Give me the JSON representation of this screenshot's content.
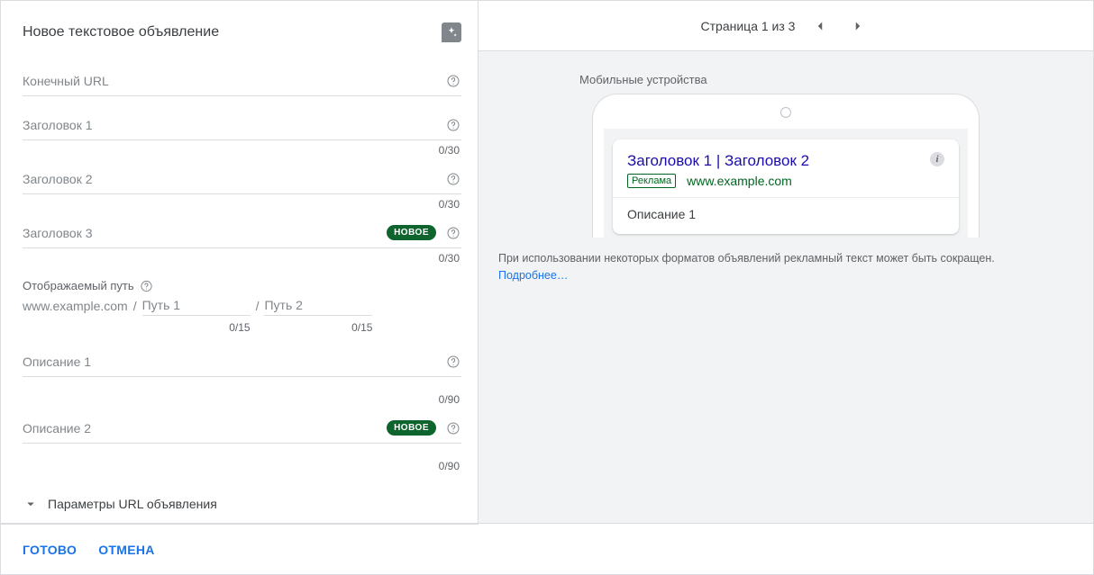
{
  "header": {
    "title": "Новое текстовое объявление"
  },
  "fields": {
    "final_url": {
      "label": "Конечный URL"
    },
    "headline1": {
      "label": "Заголовок 1",
      "counter": "0/30"
    },
    "headline2": {
      "label": "Заголовок 2",
      "counter": "0/30"
    },
    "headline3": {
      "label": "Заголовок 3",
      "counter": "0/30",
      "badge": "НОВОЕ"
    },
    "display_path": {
      "label": "Отображаемый путь",
      "base": "www.example.com",
      "path1_placeholder": "Путь 1",
      "path2_placeholder": "Путь 2",
      "path1_counter": "0/15",
      "path2_counter": "0/15"
    },
    "description1": {
      "label": "Описание 1",
      "counter": "0/90"
    },
    "description2": {
      "label": "Описание 2",
      "counter": "0/90",
      "badge": "НОВОЕ"
    }
  },
  "expander": {
    "label": "Параметры URL объявления"
  },
  "footer": {
    "done": "ГОТОВО",
    "cancel": "ОТМЕНА"
  },
  "preview": {
    "pager": "Страница 1 из 3",
    "device_label": "Мобильные устройства",
    "ad": {
      "headline": "Заголовок 1 | Заголовок 2",
      "badge": "Реклама",
      "url": "www.example.com",
      "description": "Описание 1",
      "info": "i"
    },
    "disclaimer_text": "При использовании некоторых форматов объявлений рекламный текст может быть сокращен.",
    "disclaimer_link": "Подробнее…"
  }
}
